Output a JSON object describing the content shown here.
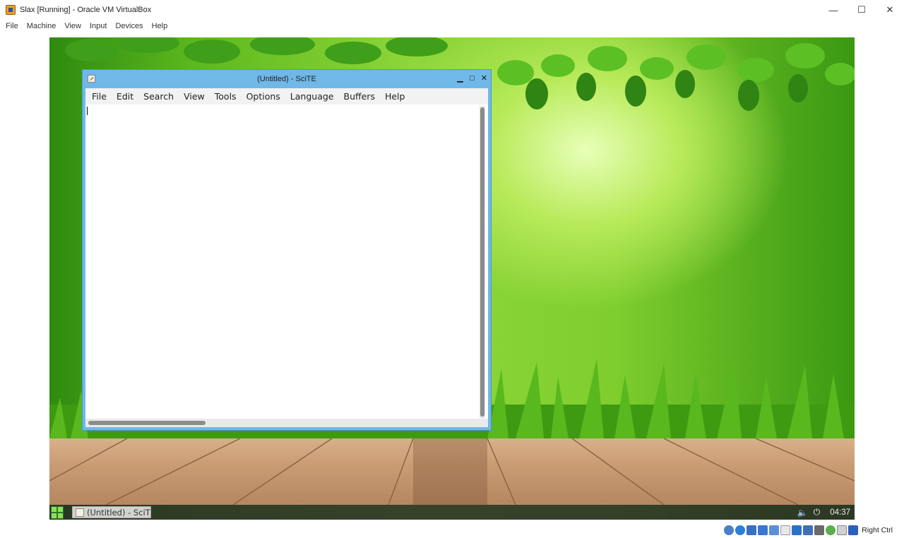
{
  "host_window": {
    "title": "Slax [Running] - Oracle VM VirtualBox",
    "controls": {
      "minimize": "—",
      "maximize": "☐",
      "close": "✕"
    },
    "menu": [
      "File",
      "Machine",
      "View",
      "Input",
      "Devices",
      "Help"
    ]
  },
  "guest": {
    "scite": {
      "title": "(Untitled) - SciTE",
      "controls": {
        "minimize": "▁",
        "maximize": "□",
        "close": "✕"
      },
      "menu": [
        "File",
        "Edit",
        "Search",
        "View",
        "Tools",
        "Options",
        "Language",
        "Buffers",
        "Help"
      ]
    },
    "taskbar": {
      "task_label": "(Untitled) - SciT",
      "clock": "04:37",
      "tray_icons": [
        "volume-icon",
        "power-icon"
      ]
    }
  },
  "status_bar": {
    "icons": [
      "hard-disk-icon",
      "optical-drive-icon",
      "audio-icon",
      "network-icon",
      "usb-icon",
      "shared-folders-icon",
      "display-icon",
      "video-capture-icon",
      "recording-icon",
      "cpu-icon",
      "mouse-integration-icon",
      "keyboard-icon"
    ],
    "host_key": "Right Ctrl"
  },
  "colors": {
    "scite_frame": "#6fb8e8",
    "taskbar": "#282828",
    "wallpaper_green": "#7fce2e"
  }
}
